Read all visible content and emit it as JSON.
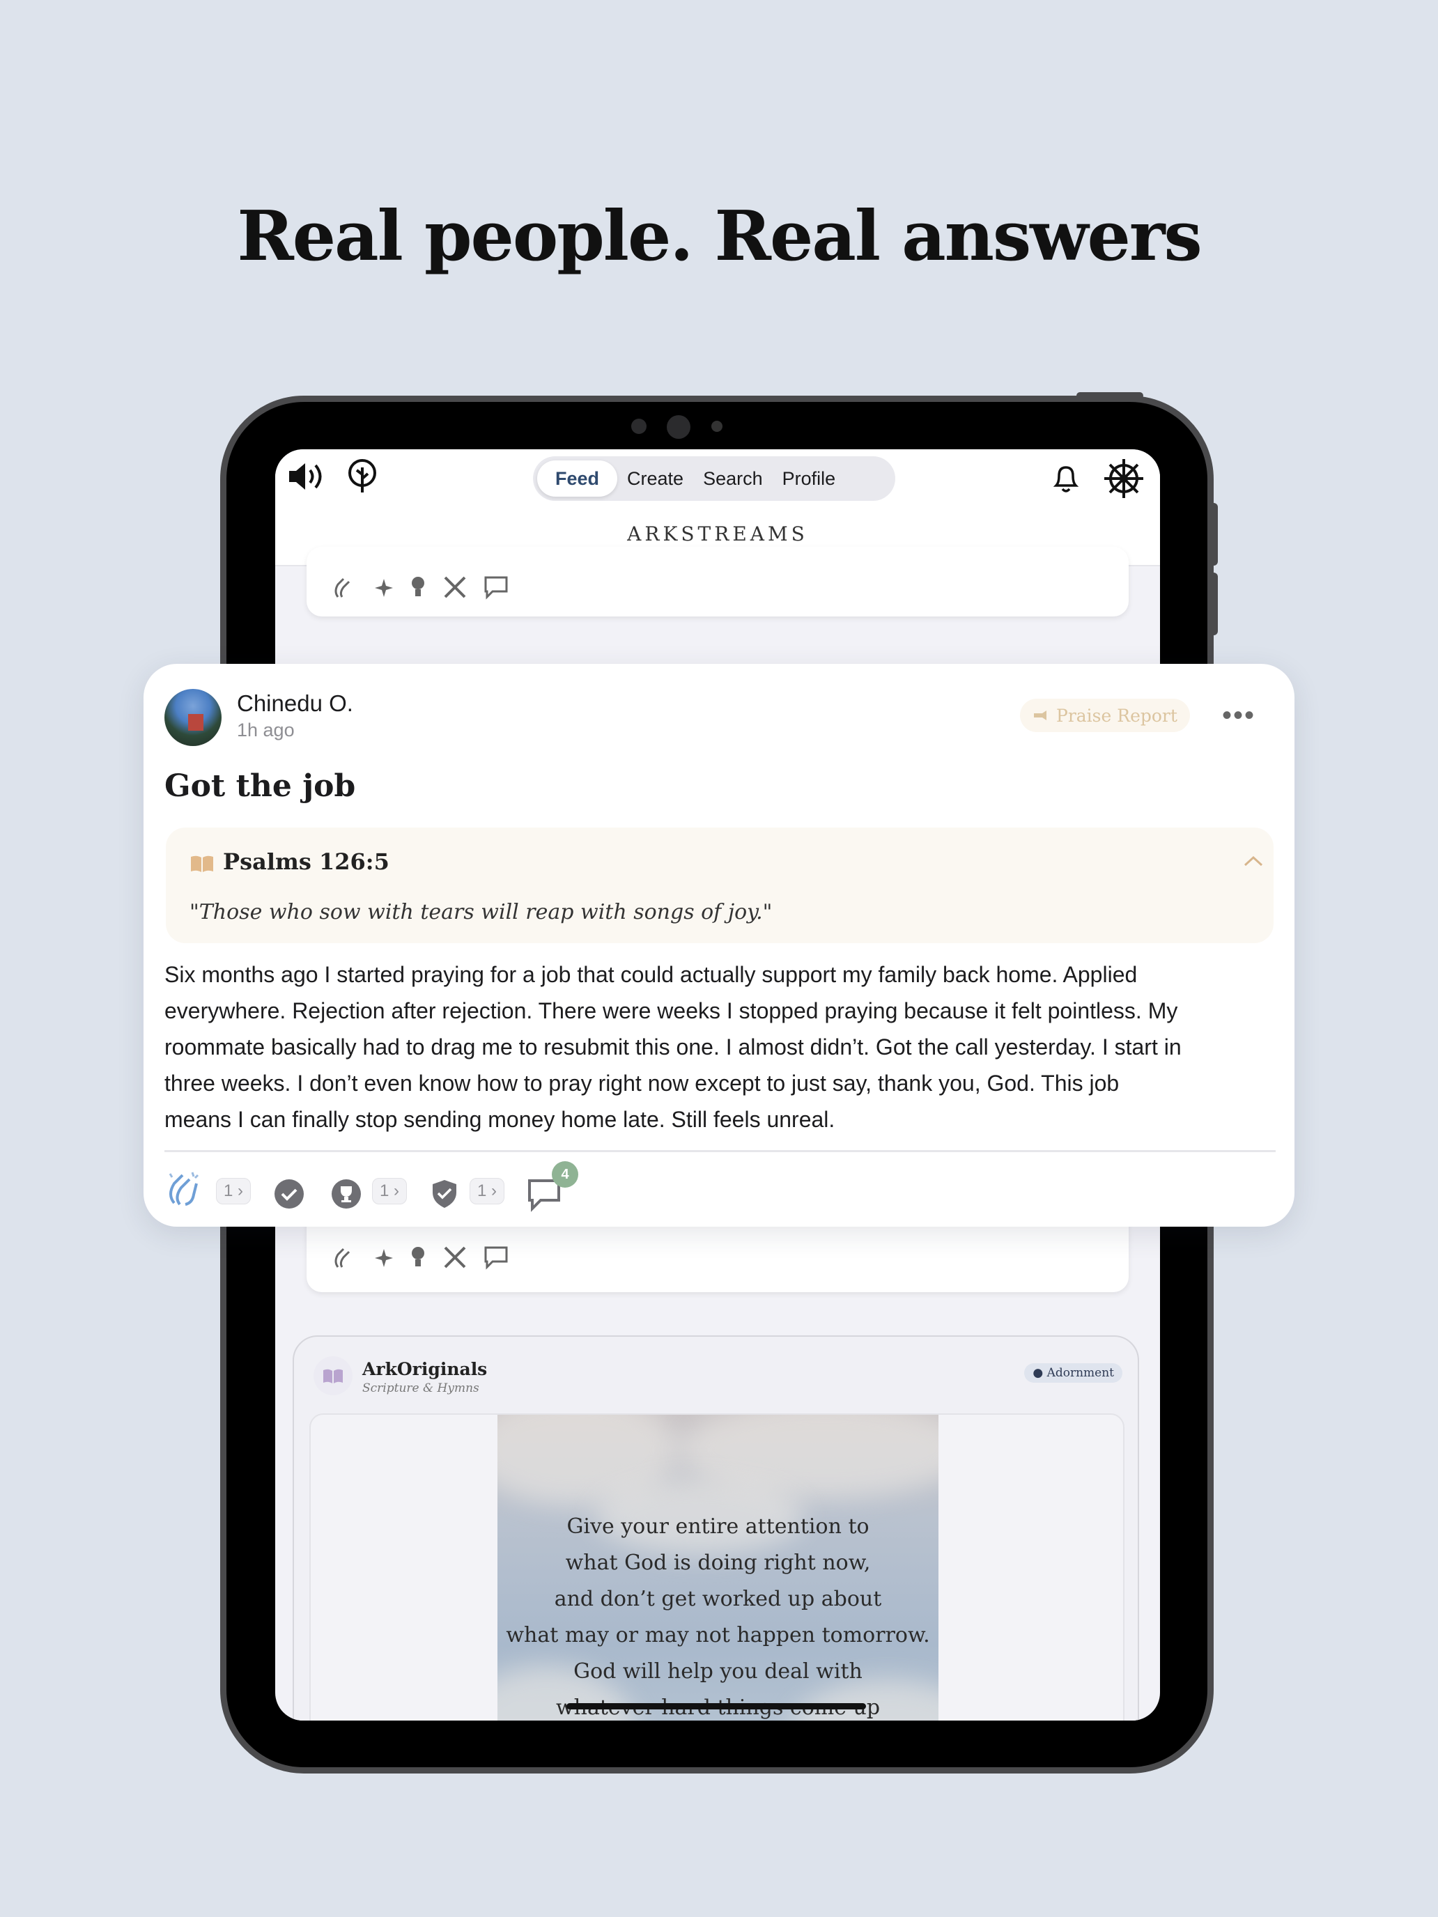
{
  "headline": "Real people. Real answers",
  "app": {
    "tabs": [
      {
        "label": "Feed",
        "active": true
      },
      {
        "label": "Create",
        "active": false
      },
      {
        "label": "Search",
        "active": false
      },
      {
        "label": "Profile",
        "active": false
      }
    ],
    "brand": "ARKSTREAMS"
  },
  "post": {
    "author": "Chinedu O.",
    "time": "1h ago",
    "badge": "Praise Report",
    "title": "Got the job",
    "verse_ref": "Psalms 126:5",
    "verse_text": "\"Those who sow with tears will reap with songs of joy.\"",
    "body_lines": [
      "Six months ago I started praying for a job that could actually support my family back home. Applied",
      "everywhere. Rejection after rejection. There were weeks I stopped praying because it felt pointless. My",
      "roommate basically had to drag me to resubmit this one. I almost didn’t. Got the call yesterday. I start in",
      "three weeks. I don’t even know how to pray right now except to just say, thank you, God. This job",
      "means I can finally stop sending money home late. Still feels unreal."
    ],
    "reactions": {
      "clap_count": "1",
      "trophy_count": "1",
      "shield_count": "1",
      "comment_count": "4"
    }
  },
  "ark_card": {
    "name": "ArkOriginals",
    "subtitle": "Scripture & Hymns",
    "badge": "Adornment",
    "quote_lines": [
      "Give your entire attention to",
      "what God is doing right now,",
      "and don’t get worked up about",
      "what may or may not happen tomorrow.",
      "God will help you deal with",
      "whatever hard things come up"
    ]
  },
  "colors": {
    "background": "#dde3ec",
    "accent": "#2f4a6e",
    "praise": "#dcc5a0",
    "comment_badge": "#8fb394"
  }
}
